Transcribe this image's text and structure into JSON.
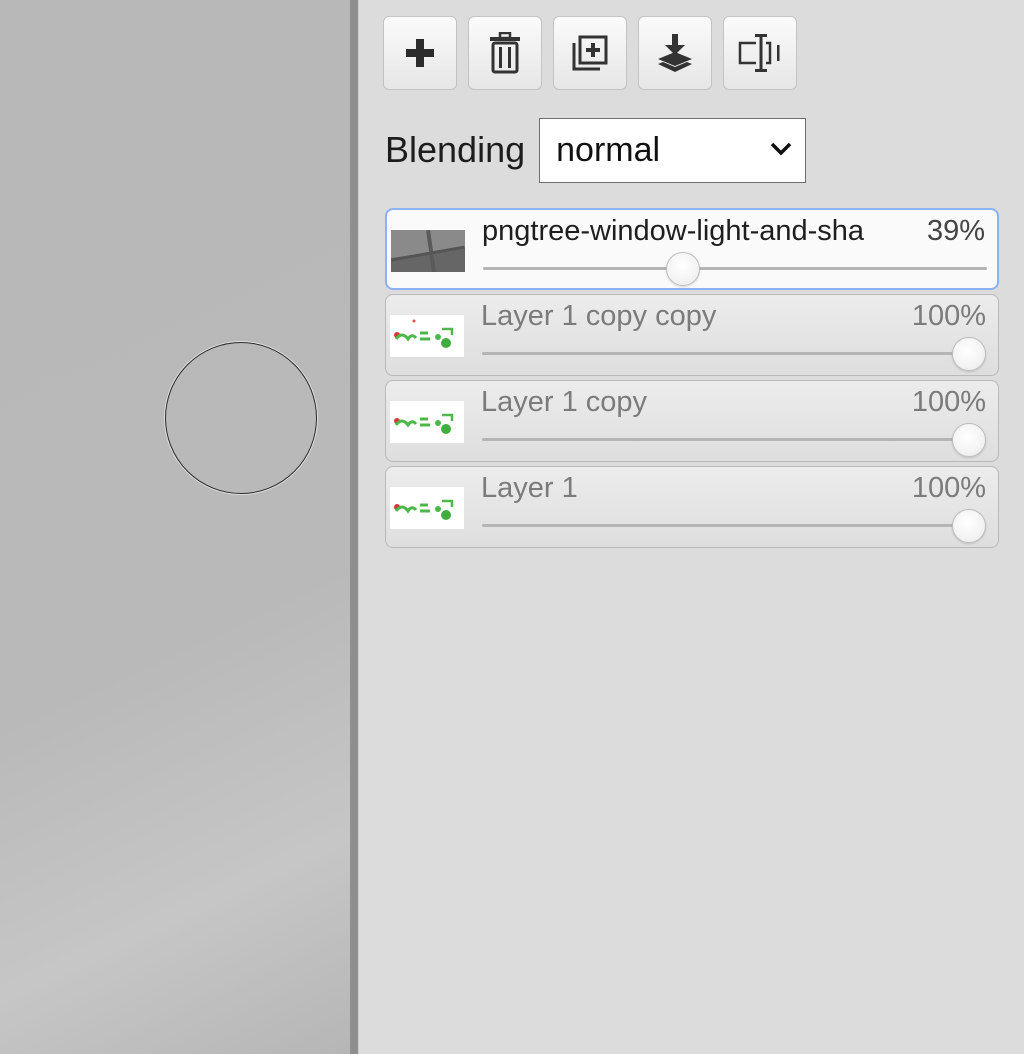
{
  "toolbar": {
    "buttons": [
      {
        "icon": "plus-icon",
        "title": "Add layer"
      },
      {
        "icon": "trash-icon",
        "title": "Delete layer"
      },
      {
        "icon": "duplicate-icon",
        "title": "Duplicate layer"
      },
      {
        "icon": "merge-down-icon",
        "title": "Merge down"
      },
      {
        "icon": "rename-icon",
        "title": "Rename layer"
      }
    ]
  },
  "blending": {
    "label": "Blending",
    "value": "normal"
  },
  "layers": [
    {
      "name": "pngtree-window-light-and-sha",
      "opacity_text": "39%",
      "opacity": 0.39,
      "active": true,
      "thumbnail": "window-shadow-thumbnail"
    },
    {
      "name": "Layer 1 copy copy",
      "opacity_text": "100%",
      "opacity": 1.0,
      "active": false,
      "thumbnail": "sprites-thumbnail"
    },
    {
      "name": "Layer 1 copy",
      "opacity_text": "100%",
      "opacity": 1.0,
      "active": false,
      "thumbnail": "sprites-thumbnail"
    },
    {
      "name": "Layer 1",
      "opacity_text": "100%",
      "opacity": 1.0,
      "active": false,
      "thumbnail": "sprites-thumbnail"
    }
  ],
  "colors": {
    "active_border": "#8ab2f4",
    "panel_bg": "#dcdcdc",
    "canvas_bg": "#b9b9b9"
  }
}
